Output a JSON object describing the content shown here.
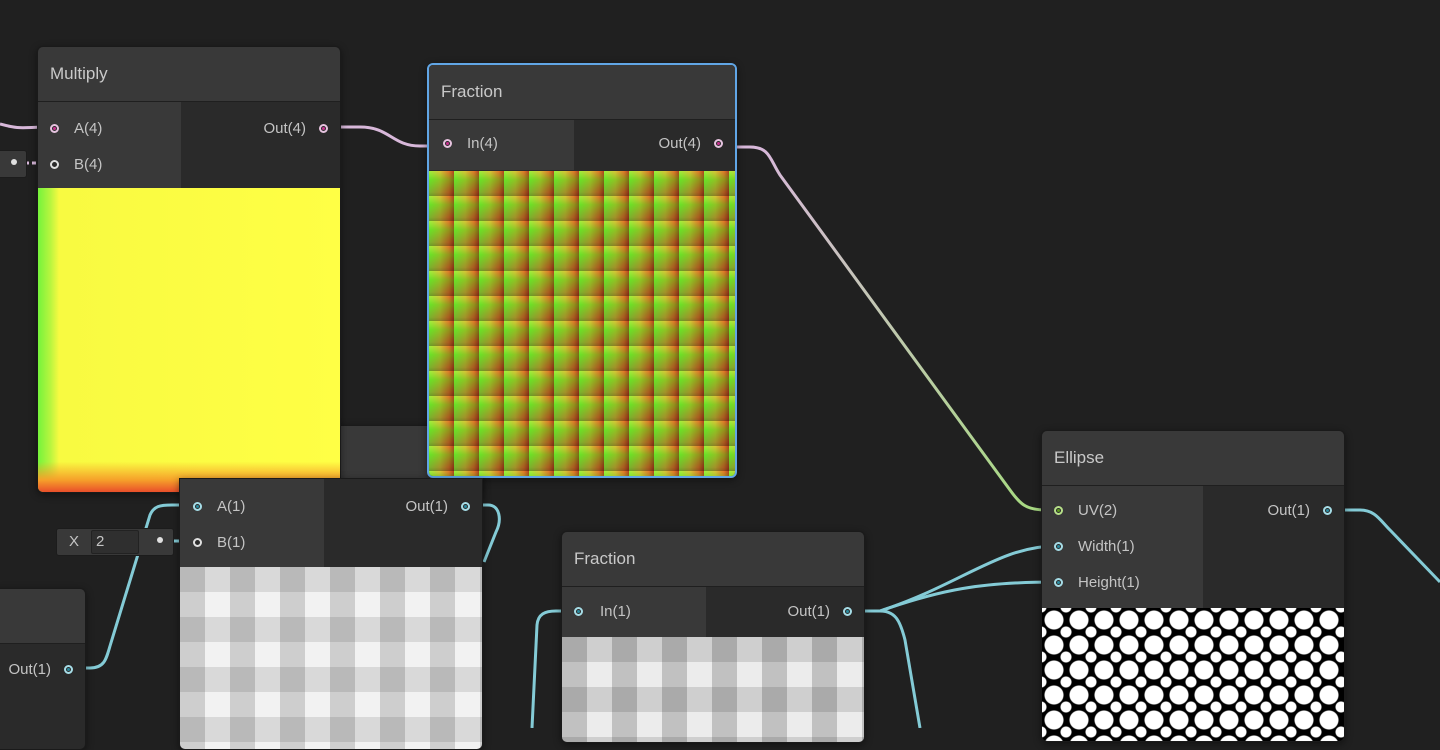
{
  "nodes": {
    "multiply": {
      "title": "Multiply",
      "inputs": [
        "A(4)",
        "B(4)"
      ],
      "output": "Out(4)"
    },
    "fraction_top": {
      "title": "Fraction",
      "inputs": [
        "In(4)"
      ],
      "output": "Out(4)"
    },
    "ellipse": {
      "title": "Ellipse",
      "inputs": [
        "UV(2)",
        "Width(1)",
        "Height(1)"
      ],
      "output": "Out(1)"
    },
    "fraction_bottom": {
      "title": "Fraction",
      "inputs": [
        "In(1)"
      ],
      "output": "Out(1)"
    },
    "multiply_lower": {
      "inputs": [
        "A(1)",
        "B(1)"
      ],
      "output": "Out(1)"
    },
    "left_partial": {
      "output": "Out(1)"
    }
  },
  "inline_field": {
    "label": "X",
    "value": "2"
  },
  "colors": {
    "background": "#202020",
    "node_body": "#2a2a2a",
    "node_header": "#393939",
    "selection": "#61a6e6",
    "wire_vector4": "#d8b8da",
    "wire_vector1": "#84cbd6",
    "wire_vector2": "#a7d982"
  },
  "icons": [
    "port-dot"
  ]
}
